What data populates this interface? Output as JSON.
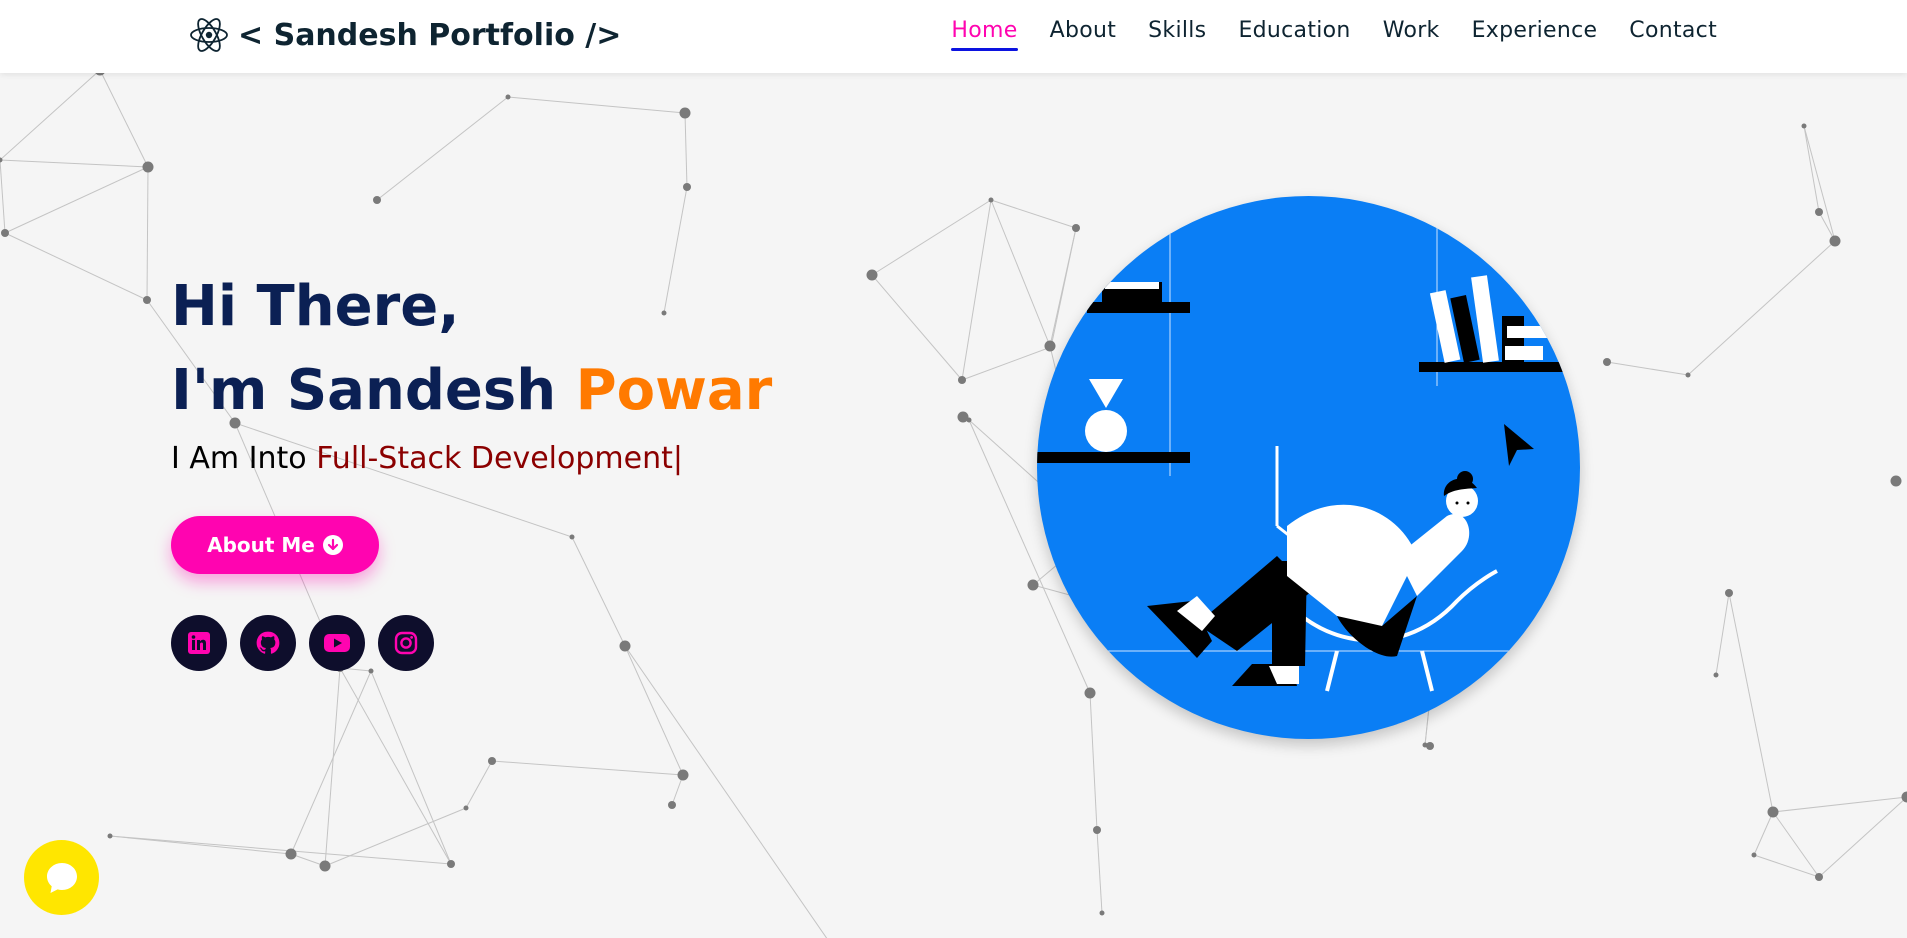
{
  "header": {
    "logo_text": "< Sandesh Portfolio />",
    "logo_icon": "react-atom-icon",
    "nav": [
      {
        "label": "Home",
        "active": true
      },
      {
        "label": "About",
        "active": false
      },
      {
        "label": "Skills",
        "active": false
      },
      {
        "label": "Education",
        "active": false
      },
      {
        "label": "Work",
        "active": false
      },
      {
        "label": "Experience",
        "active": false
      },
      {
        "label": "Contact",
        "active": false
      }
    ]
  },
  "hero": {
    "greeting": "Hi There,",
    "name_prefix": "I'm Sandesh ",
    "name_accent": "Powar",
    "tagline_prefix": "I Am Into ",
    "tagline_role": "Full-Stack Development|",
    "cta_label": "About Me",
    "cta_icon": "arrow-down-circle-icon",
    "socials": [
      {
        "icon": "linkedin-icon"
      },
      {
        "icon": "github-icon"
      },
      {
        "icon": "youtube-icon"
      },
      {
        "icon": "instagram-icon"
      }
    ],
    "illustration": "person-reclining-with-laptop-illustration"
  },
  "chat": {
    "icon": "chat-bubble-icon"
  },
  "colors": {
    "accent_pink": "#ff04b0",
    "accent_orange": "#ff7a00",
    "heading_navy": "#0b2054",
    "role_red": "#8b0000",
    "hero_circle_blue": "#0a7ef5",
    "chat_yellow": "#ffe600",
    "nav_underline": "#0c13e0"
  }
}
